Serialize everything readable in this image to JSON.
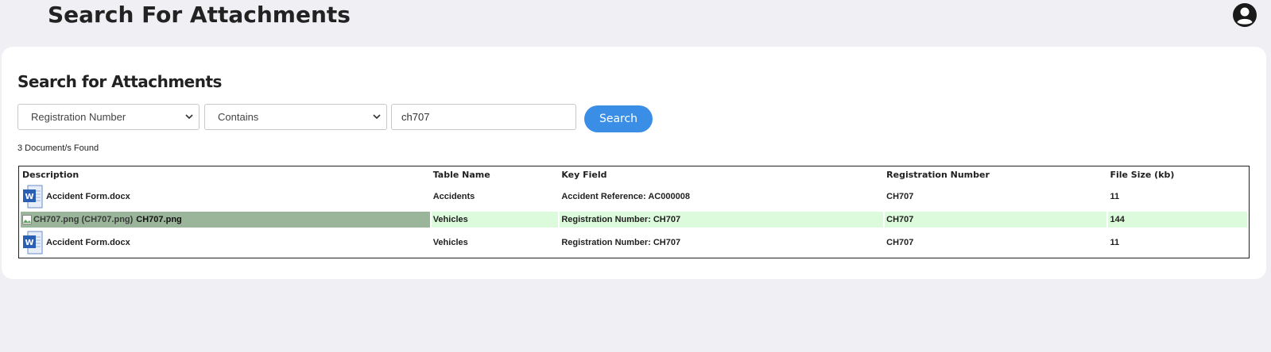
{
  "header": {
    "title": "Search For Attachments",
    "user_icon": "user-circle-icon"
  },
  "card": {
    "title": "Search for Attachments",
    "field_select": "Registration Number",
    "operator_select": "Contains",
    "search_value": "ch707",
    "search_button": "Search",
    "result_count": "3 Document/s Found"
  },
  "table": {
    "headers": [
      "Description",
      "Table Name",
      "Key Field",
      "Registration Number",
      "File Size (kb)"
    ],
    "rows": [
      {
        "description": "Accident Form.docx",
        "icon": "word-doc-icon",
        "table_name": "Accidents",
        "key_field": "Accident Reference: AC000008",
        "registration": "CH707",
        "file_size": "11"
      },
      {
        "description": "CH707.png",
        "image_alt": "CH707.png (CH707.png)",
        "table_name": "Vehicles",
        "key_field": "Registration Number: CH707",
        "registration": "CH707",
        "file_size": "144"
      },
      {
        "description": "Accident Form.docx",
        "icon": "word-doc-icon",
        "table_name": "Vehicles",
        "key_field": "Registration Number: CH707",
        "registration": "CH707",
        "file_size": "11"
      }
    ]
  },
  "colors": {
    "page_bg": "#f0eff4",
    "button": "#3a8ee6",
    "row_highlight": "#dcfadc",
    "cell_highlight": "#9ab59a"
  }
}
